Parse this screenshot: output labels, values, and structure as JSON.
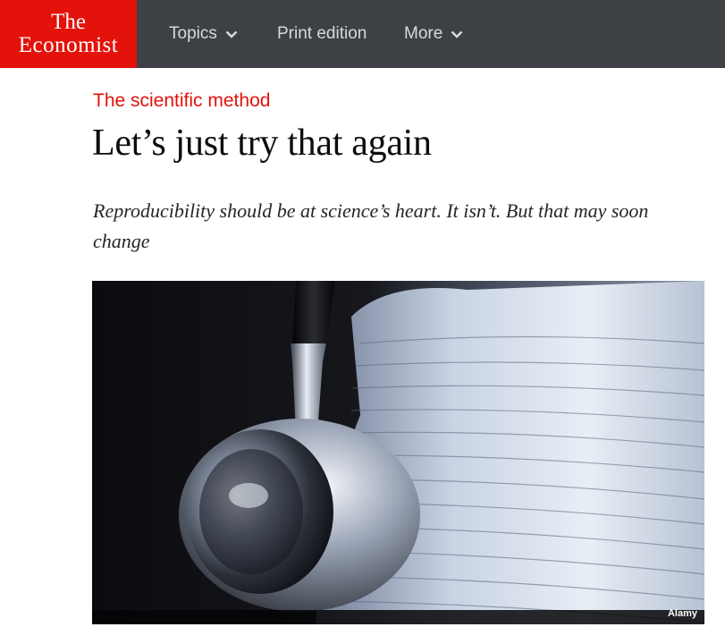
{
  "header": {
    "logo": {
      "line1": "The",
      "line2": "Economist"
    },
    "nav": [
      {
        "label": "Topics",
        "has_dropdown": true
      },
      {
        "label": "Print edition",
        "has_dropdown": false
      },
      {
        "label": "More",
        "has_dropdown": true
      }
    ]
  },
  "article": {
    "kicker": "The scientific method",
    "headline": "Let’s just try that again",
    "rubric": "Reproducibility should be at science’s heart. It isn’t. But that may soon change",
    "image": {
      "subject": "stethoscope resting beside a tall stack of papers",
      "credit": "Alamy"
    }
  },
  "colors": {
    "brand_red": "#e3120b",
    "nav_bg": "#3d4044",
    "nav_text": "#d8d9da",
    "headline": "#0d0d0d"
  }
}
